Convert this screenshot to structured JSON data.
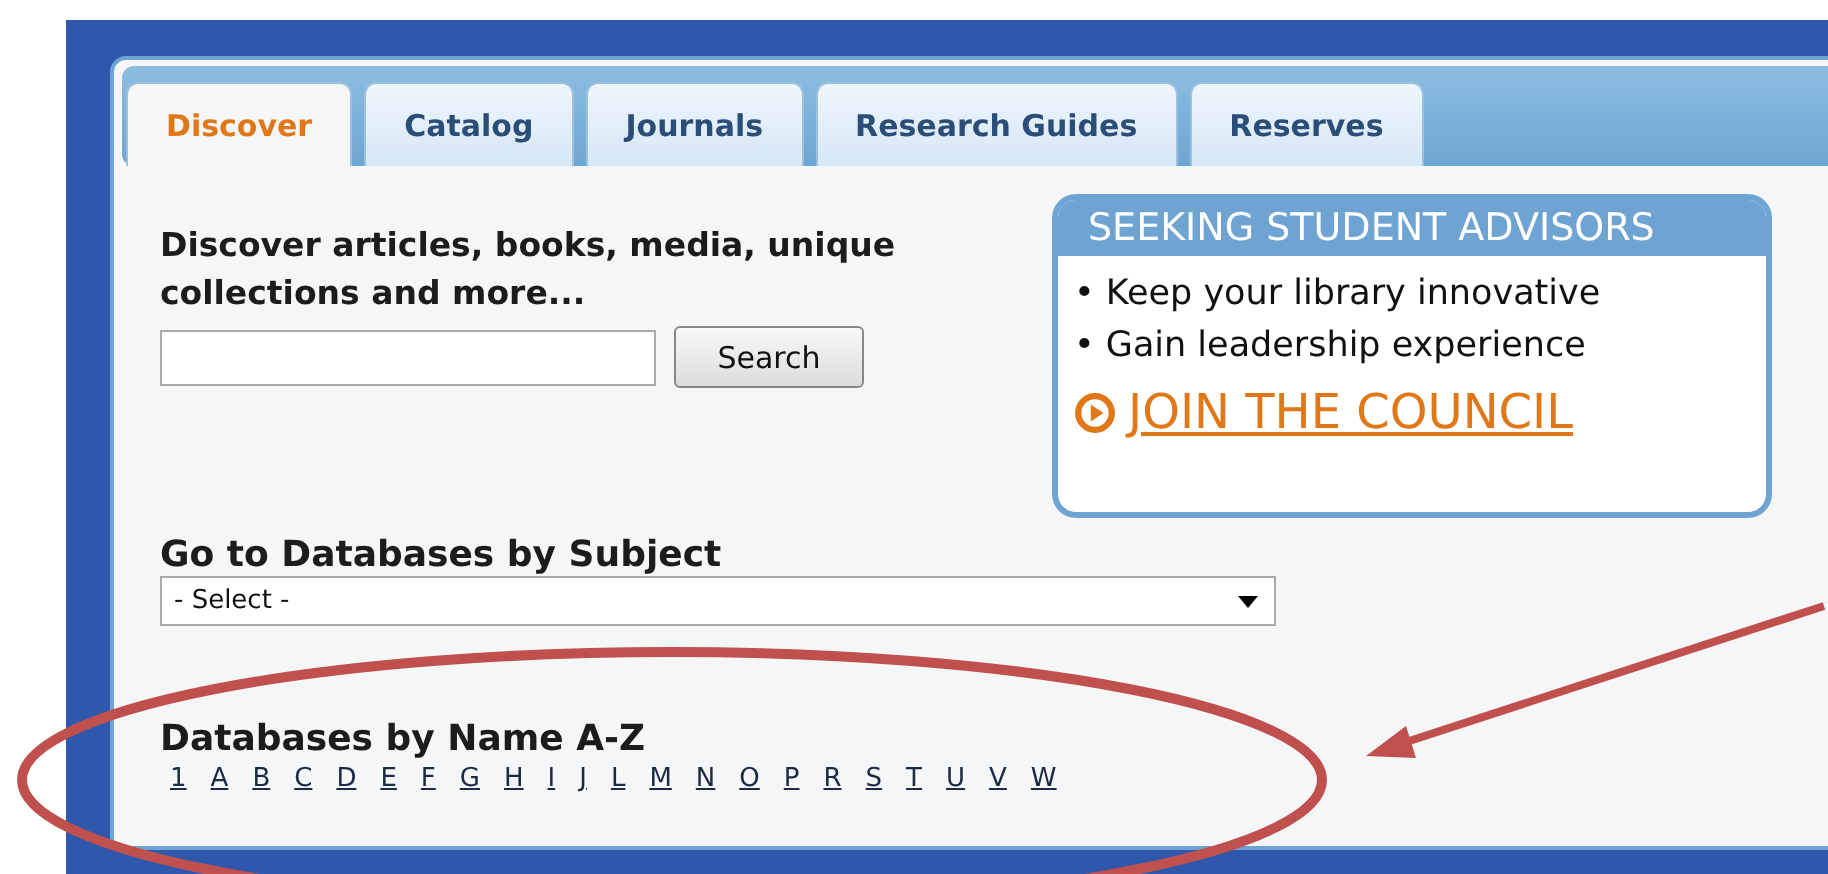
{
  "tabs": [
    {
      "label": "Discover",
      "selected": true
    },
    {
      "label": "Catalog",
      "selected": false
    },
    {
      "label": "Journals",
      "selected": false
    },
    {
      "label": "Research Guides",
      "selected": false
    },
    {
      "label": "Reserves",
      "selected": false
    }
  ],
  "search": {
    "heading": "Discover articles, books, media, unique collections and more...",
    "button": "Search"
  },
  "promo": {
    "title": "SEEKING STUDENT ADVISORS",
    "bullets": [
      "• Keep your library innovative",
      "• Gain leadership experience"
    ],
    "link": "JOIN THE COUNCIL"
  },
  "subject": {
    "heading": "Go to Databases by Subject",
    "select": "- Select -"
  },
  "az": {
    "heading": "Databases by Name A-Z",
    "letters": [
      "1",
      "A",
      "B",
      "C",
      "D",
      "E",
      "F",
      "G",
      "H",
      "I",
      "J",
      "L",
      "M",
      "N",
      "O",
      "P",
      "R",
      "S",
      "T",
      "U",
      "V",
      "W"
    ]
  },
  "annotation": {
    "kind": "ellipse-arrow"
  }
}
